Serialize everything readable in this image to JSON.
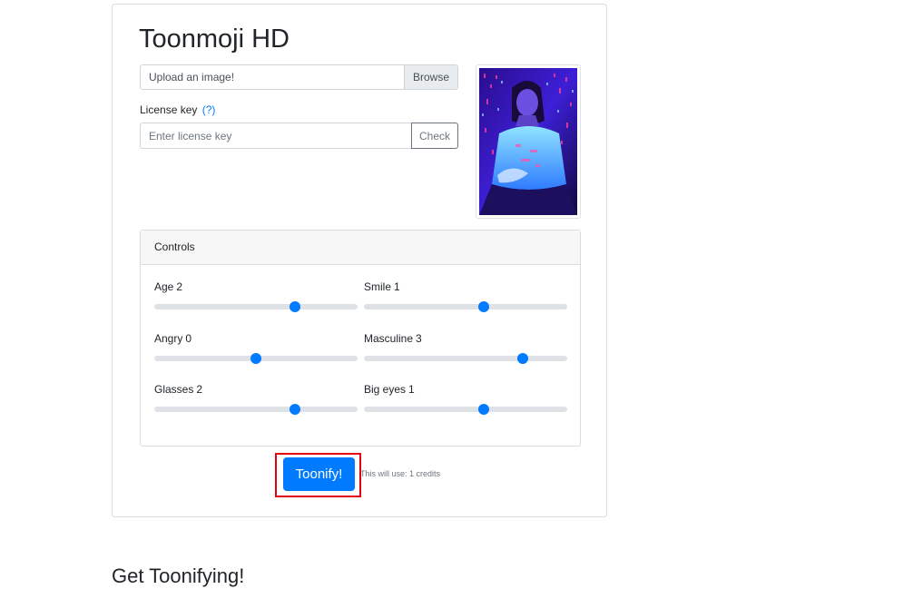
{
  "app": {
    "title": "Toonmoji HD"
  },
  "upload": {
    "label": "Upload an image!",
    "browse_label": "Browse"
  },
  "license": {
    "label": "License key",
    "help_link": "(?)",
    "placeholder": "Enter license key",
    "value": "",
    "check_label": "Check"
  },
  "preview": {
    "icon": "uploaded-photo-thumbnail"
  },
  "controls": {
    "header": "Controls",
    "sliders": [
      {
        "label": "Age",
        "value": "2",
        "level": 0.69
      },
      {
        "label": "Smile",
        "value": "1",
        "level": 0.59
      },
      {
        "label": "Angry",
        "value": "0",
        "level": 0.5
      },
      {
        "label": "Masculine",
        "value": "3",
        "level": 0.78
      },
      {
        "label": "Glasses",
        "value": "2",
        "level": 0.69
      },
      {
        "label": "Big eyes",
        "value": "1",
        "level": 0.59
      }
    ]
  },
  "actions": {
    "toonify_label": "Toonify!",
    "credits_note": "This will use: 1 credits"
  },
  "section": {
    "heading": "Get Toonifying!"
  },
  "colors": {
    "accent": "#007bff",
    "highlight": "#e3000f"
  }
}
